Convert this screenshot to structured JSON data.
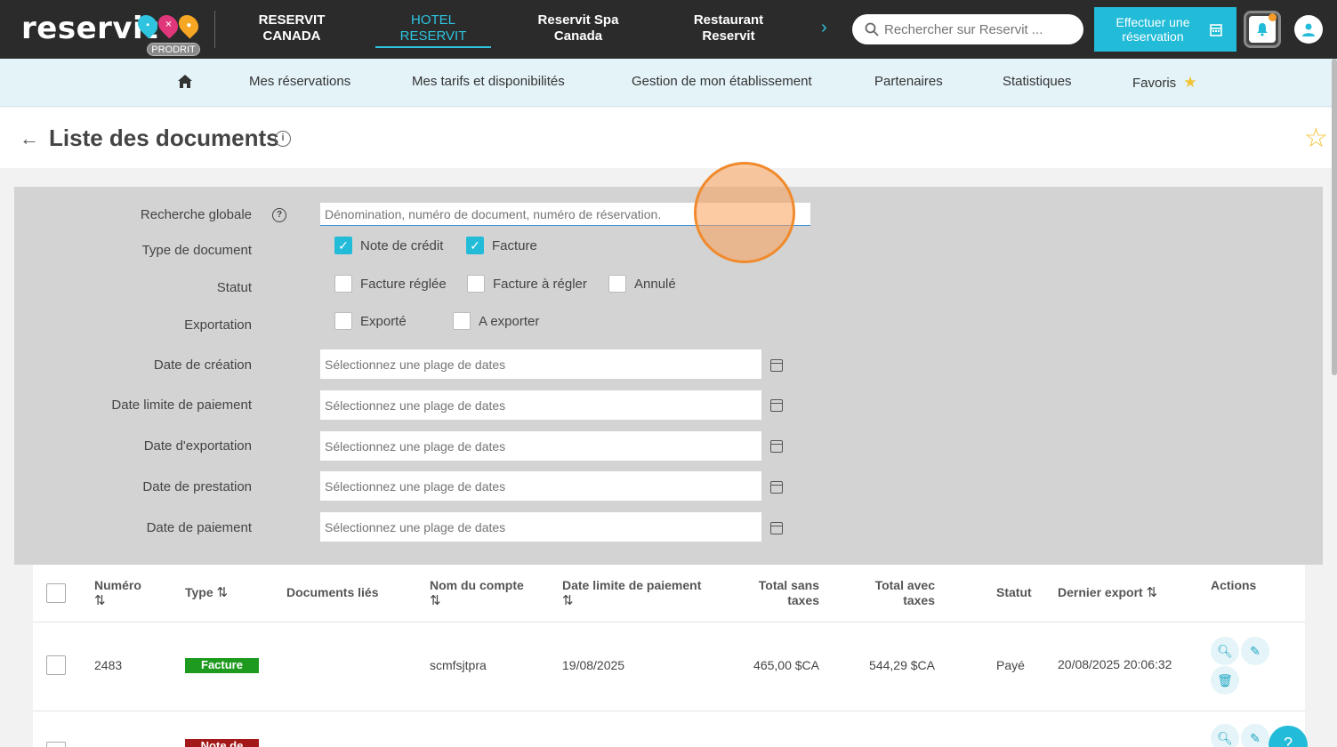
{
  "topbar": {
    "logo": "reservit",
    "badge": "PRODRIT",
    "nav": [
      {
        "label": "RESERVIT\nCANADA"
      },
      {
        "label": "HOTEL\nRESERVIT"
      },
      {
        "label": "Reservit Spa\nCanada"
      },
      {
        "label": "Restaurant\nReservit"
      }
    ],
    "search_placeholder": "Rechercher sur Reservit ...",
    "reserve_button": "Effectuer une réservation"
  },
  "subnav": {
    "items": [
      "Mes réservations",
      "Mes tarifs et disponibilités",
      "Gestion de mon établissement",
      "Partenaires",
      "Statistiques",
      "Favoris"
    ]
  },
  "header": {
    "title": "Liste des documents"
  },
  "filters": {
    "global_search_label": "Recherche globale",
    "global_search_placeholder": "Dénomination, numéro de document, numéro de réservation.",
    "doc_type_label": "Type de document",
    "doc_types": [
      {
        "label": "Note de crédit",
        "checked": true
      },
      {
        "label": "Facture",
        "checked": true
      }
    ],
    "status_label": "Statut",
    "statuses": [
      {
        "label": "Facture réglée",
        "checked": false
      },
      {
        "label": "Facture à régler",
        "checked": false
      },
      {
        "label": "Annulé",
        "checked": false
      }
    ],
    "export_label": "Exportation",
    "exports": [
      {
        "label": "Exporté",
        "checked": false
      },
      {
        "label": "A exporter",
        "checked": false
      }
    ],
    "date_placeholder": "Sélectionnez une plage de dates",
    "dates": [
      "Date de création",
      "Date limite de paiement",
      "Date d'exportation",
      "Date de prestation",
      "Date de paiement"
    ]
  },
  "table": {
    "headers": {
      "numero": "Numéro",
      "type": "Type",
      "docs": "Documents liés",
      "compte": "Nom du compte",
      "limite": "Date limite de paiement",
      "ht": "Total sans taxes",
      "ttc": "Total avec taxes",
      "statut": "Statut",
      "export": "Dernier export",
      "actions": "Actions"
    },
    "rows": [
      {
        "numero": "2483",
        "type": "Facture",
        "type_color": "#1e9a1e",
        "compte": "scmfsjtpra",
        "limite": "19/08/2025",
        "ht": "465,00 $CA",
        "ttc": "544,29 $CA",
        "statut": "Payé",
        "export": "20/08/2025 20:06:32"
      },
      {
        "numero": "",
        "type": "Note de",
        "type_color": "#a31818"
      }
    ]
  },
  "help_button": "?"
}
